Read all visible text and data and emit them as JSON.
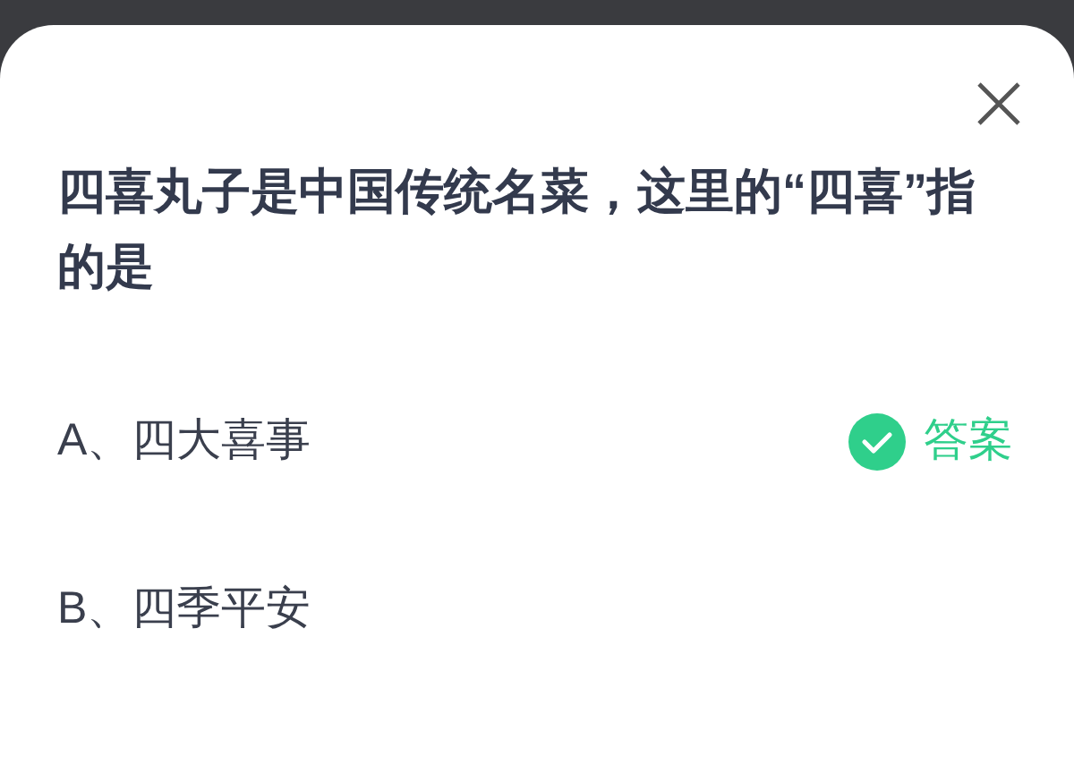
{
  "question": "四喜丸子是中国传统名菜，这里的“四喜”指的是",
  "options": [
    {
      "text": "A、四大喜事",
      "correct": true,
      "answer_label": "答案"
    },
    {
      "text": "B、四季平安",
      "correct": false
    }
  ]
}
